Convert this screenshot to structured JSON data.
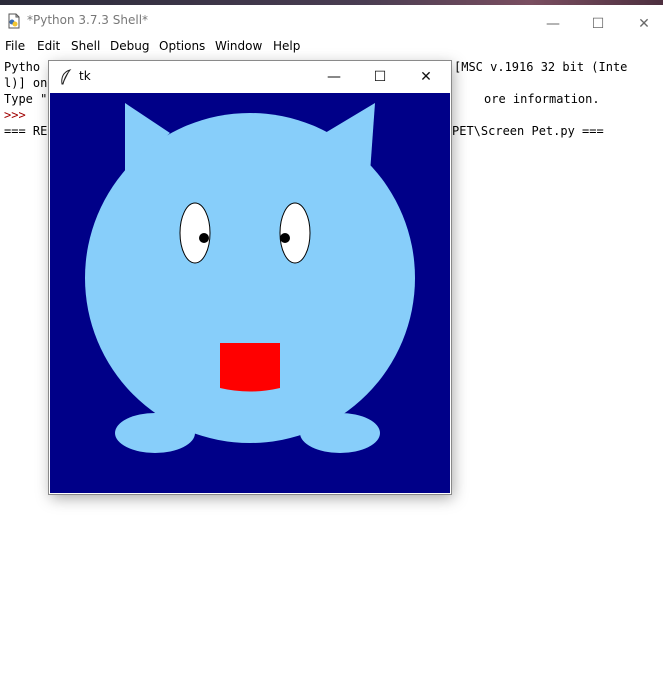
{
  "shell": {
    "title": "*Python 3.7.3 Shell*",
    "menu": [
      "File",
      "Edit",
      "Shell",
      "Debug",
      "Options",
      "Window",
      "Help"
    ],
    "lines": {
      "line1_left": "Pytho",
      "line1_right": "[MSC v.1916 32 bit (Inte",
      "line2": "l)] on",
      "line3_left": "Type \"",
      "line3_right": "ore information.",
      "prompt": ">>>",
      "line5_left": "=== RE",
      "line5_right": "PET\\Screen Pet.py ==="
    },
    "window_controls": {
      "minimize": "—",
      "maximize": "☐",
      "close": "✕"
    }
  },
  "tk": {
    "title": "tk",
    "window_controls": {
      "minimize": "—",
      "maximize": "☐",
      "close": "✕"
    }
  },
  "colors": {
    "canvas_background": "#000088",
    "pet_body": "#87cefa",
    "mouth": "#ff0000",
    "eye_white": "#ffffff",
    "pupil": "#000000",
    "prompt": "#a00000"
  },
  "icons": {
    "shell_app_icon": "idle-document-icon",
    "tk_app_icon": "feather-icon"
  }
}
